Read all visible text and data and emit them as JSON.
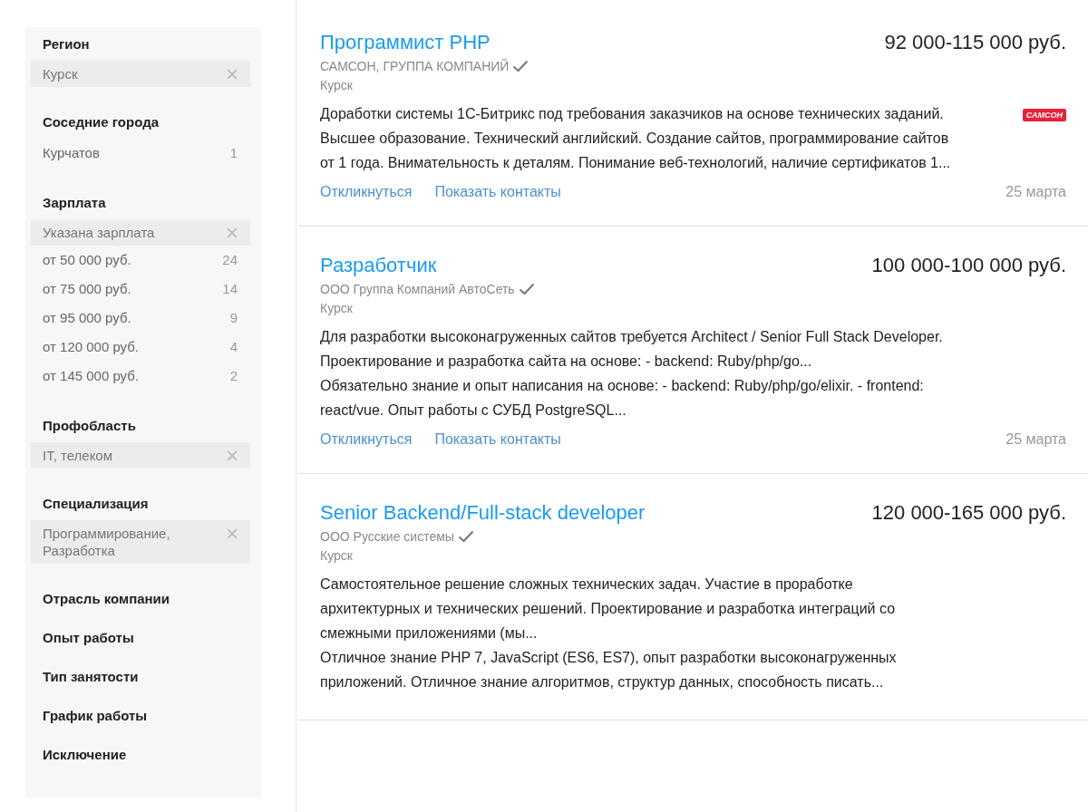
{
  "filters": [
    {
      "title": "Регион",
      "items": [
        {
          "kind": "chip",
          "label": "Курск",
          "remove": "×"
        }
      ]
    },
    {
      "title": "Соседние города",
      "items": [
        {
          "kind": "option",
          "label": "Курчатов",
          "count": "1"
        }
      ]
    },
    {
      "title": "Зарплата",
      "items": [
        {
          "kind": "chip",
          "label": "Указана зарплата",
          "remove": "×"
        },
        {
          "kind": "option",
          "label": "от 50 000 руб.",
          "count": "24"
        },
        {
          "kind": "option",
          "label": "от 75 000 руб.",
          "count": "14"
        },
        {
          "kind": "option",
          "label": "от 95 000 руб.",
          "count": "9"
        },
        {
          "kind": "option",
          "label": "от 120 000 руб.",
          "count": "4"
        },
        {
          "kind": "option",
          "label": "от 145 000 руб.",
          "count": "2"
        }
      ]
    },
    {
      "title": "Профобласть",
      "items": [
        {
          "kind": "chip",
          "label": "IT, телеком",
          "remove": "×"
        }
      ]
    },
    {
      "title": "Специализация",
      "items": [
        {
          "kind": "chip",
          "label": "Программирование, Разработка",
          "remove": "×"
        }
      ]
    },
    {
      "title": "Отрасль компании"
    },
    {
      "title": "Опыт работы"
    },
    {
      "title": "Тип занятости"
    },
    {
      "title": "График работы"
    },
    {
      "title": "Исключение"
    }
  ],
  "vacancies": [
    {
      "title": "Программист PHP",
      "salary": "92 000-115 000 руб.",
      "company": "САМСОН, ГРУППА КОМПАНИЙ",
      "verified": true,
      "city": "Курск",
      "logo": "САМСОН",
      "paragraphs": [
        "Доработки системы 1С-Битрикс под требования заказчиков на основе технических заданий.",
        "Высшее образование. Технический английский. Создание сайтов, программирование сайтов от 1 года. Внимательность к деталям. Понимание веб-технологий, наличие сертификатов 1..."
      ],
      "actions": [
        "Откликнуться",
        "Показать контакты"
      ],
      "date": "25 марта"
    },
    {
      "title": "Разработчик",
      "salary": "100 000-100 000 руб.",
      "company": "ООО Группа Компаний АвтоСеть",
      "verified": true,
      "city": "Курск",
      "paragraphs": [
        "Для разработки высоконагруженных сайтов требуется Architect / Senior Full Stack Developer. Проектирование и разработка сайта на основе: - backend: Ruby/php/go...",
        "Обязательно знание и опыт написания на основе: - backend: Ruby/php/go/elixir. - frontend: react/vue. Опыт работы с СУБД PostgreSQL..."
      ],
      "actions": [
        "Откликнуться",
        "Показать контакты"
      ],
      "date": "25 марта"
    },
    {
      "title": "Senior Backend/Full-stack developer",
      "salary": "120 000-165 000 руб.",
      "company": "ООО Русские системы",
      "verified": true,
      "city": "Курск",
      "paragraphs": [
        "Самостоятельное решение сложных технических задач. Участие в проработке архитектурных и технических решений. Проектирование и разработка интеграций со смежными приложениями (мы...",
        "Отличное знание PHP 7, JavaScript (ES6, ES7), опыт разработки высоконагруженных приложений. Отличное знание алгоритмов, структур данных, способность писать..."
      ]
    }
  ]
}
